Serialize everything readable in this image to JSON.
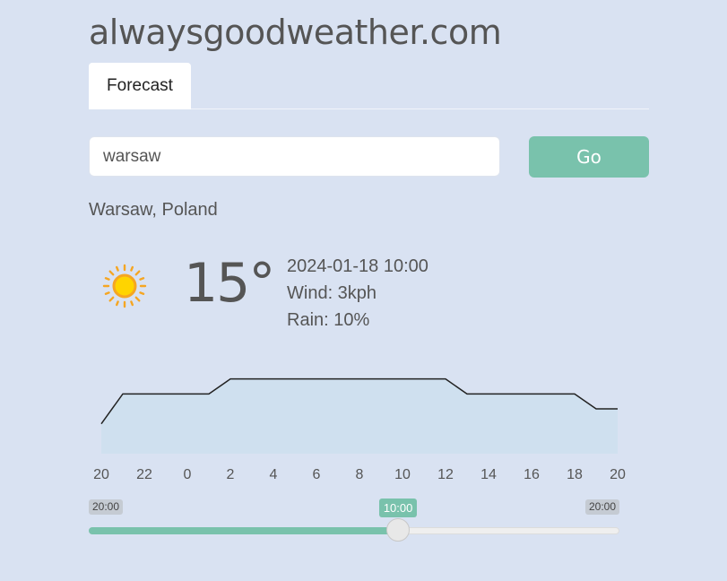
{
  "site": {
    "title": "alwaysgoodweather.com"
  },
  "tabs": [
    {
      "label": "Forecast"
    }
  ],
  "search": {
    "value": "warsaw",
    "go_label": "Go"
  },
  "location": "Warsaw, Poland",
  "current": {
    "icon": "sun-icon",
    "temperature": "15°",
    "datetime": "2024-01-18 10:00",
    "wind": "Wind: 3kph",
    "rain": "Rain: 10%"
  },
  "slider": {
    "min_label": "20:00",
    "max_label": "20:00",
    "current_label": "10:00",
    "value_fraction": 0.5833
  },
  "colors": {
    "accent": "#79c2ac",
    "background": "#d9e2f2",
    "chart_fill": "#cfe0ef",
    "chart_line": "#222222"
  },
  "chart_data": {
    "type": "area",
    "title": "",
    "xlabel": "",
    "ylabel": "",
    "x_tick_labels": [
      "20",
      "22",
      "0",
      "2",
      "4",
      "6",
      "8",
      "10",
      "12",
      "14",
      "16",
      "18",
      "20"
    ],
    "hours": [
      20,
      21,
      22,
      23,
      0,
      1,
      2,
      3,
      4,
      5,
      6,
      7,
      8,
      9,
      10,
      11,
      12,
      13,
      14,
      15,
      16,
      17,
      18,
      19,
      20
    ],
    "values": [
      12,
      14,
      14,
      14,
      14,
      14,
      15,
      15,
      15,
      15,
      15,
      15,
      15,
      15,
      15,
      15,
      15,
      14,
      14,
      14,
      14,
      14,
      14,
      13,
      13
    ],
    "ylim": [
      10,
      16
    ],
    "grid": false
  }
}
